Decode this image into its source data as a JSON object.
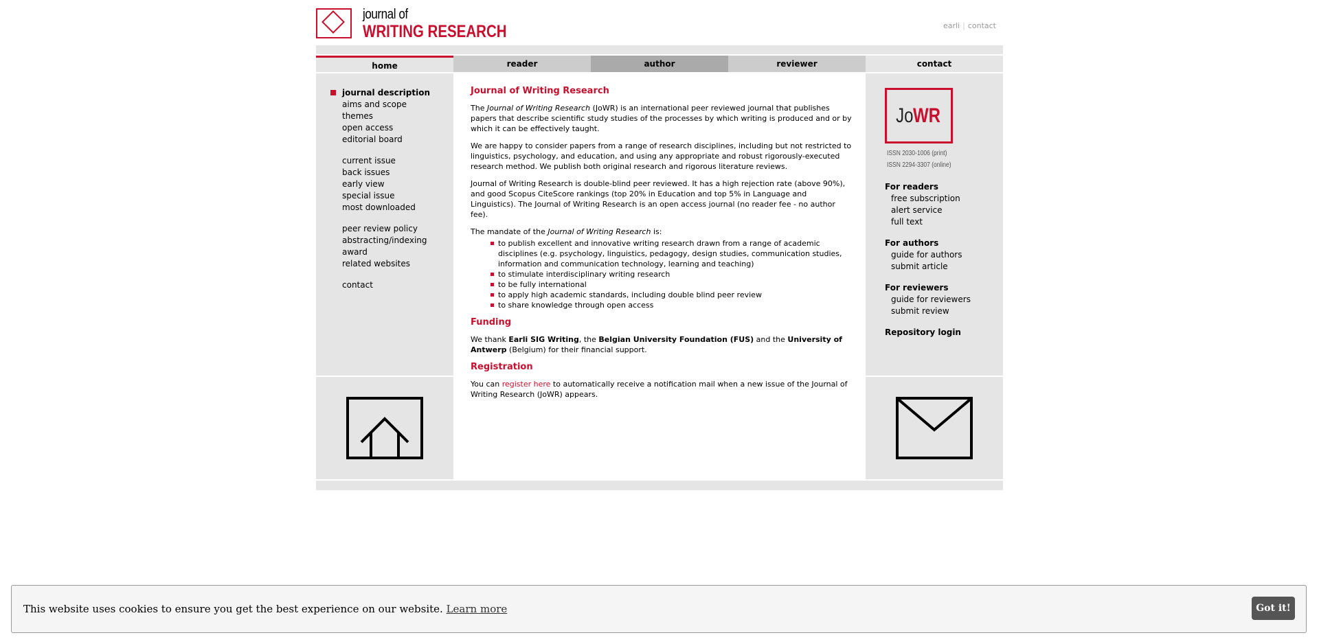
{
  "header": {
    "logo_line1": "journal of",
    "logo_line2": "WRITING RESEARCH",
    "toplinks": [
      "earli",
      "contact"
    ]
  },
  "nav": {
    "tabs": [
      {
        "label": "home"
      },
      {
        "label": "reader"
      },
      {
        "label": "author"
      },
      {
        "label": "reviewer"
      },
      {
        "label": "contact"
      }
    ]
  },
  "left_nav": {
    "group1": [
      "journal description",
      "aims and scope",
      "themes",
      "open access",
      "editorial board"
    ],
    "group2": [
      "current issue",
      "back issues",
      "early view",
      "special issue",
      "most downloaded"
    ],
    "group3": [
      "peer review policy",
      "abstracting/indexing",
      "award",
      "related websites"
    ],
    "group4": [
      "contact"
    ]
  },
  "main": {
    "title": "Journal of Writing Research",
    "p1_a": "The ",
    "p1_b": "Journal of Writing Research",
    "p1_c": " (JoWR) is an international peer reviewed journal that publishes papers that describe scientific study studies of the processes by which writing is produced and or by which it can be effectively taught.",
    "p2": "We are happy to consider papers from a range of research disciplines, including but not restricted to linguistics, psychology, and education, and using any appropriate and robust rigorously-executed research method. We publish both original research and rigorous literature reviews.",
    "p3": "Journal of Writing Research is double-blind peer reviewed. It has a high rejection rate (above 90%), and good Scopus CiteScore rankings (top 20% in Education and top 5% in Language and Linguistics). The Journal of Writing Research is an open access journal (no reader fee - no author fee).",
    "p4_a": "The mandate of the ",
    "p4_b": "Journal of Writing Research",
    "p4_c": " is:",
    "mandate": [
      "to publish excellent and innovative writing research drawn from a range of academic disciplines (e.g. psychology, linguistics, pedagogy, design studies, communication studies, information and communication technology, learning and teaching)",
      "to stimulate interdisciplinary writing research",
      "to be fully international",
      "to apply high academic standards, including double blind peer review",
      "to share knowledge through open access"
    ],
    "funding_title": "Funding",
    "funding_a": "We thank ",
    "funding_b": "Earli SIG Writing",
    "funding_c": ", the ",
    "funding_d": "Belgian University Foundation (FUS)",
    "funding_e": " and the ",
    "funding_f": "University of Antwerp",
    "funding_g": " (Belgium) for their financial support.",
    "registration_title": "Registration",
    "reg_a": "You can ",
    "reg_link": "register here",
    "reg_b": " to automatically receive a notification mail when a new issue of the Journal of Writing Research (JoWR) appears."
  },
  "right": {
    "logo_jo": "Jo",
    "logo_wr": "WR",
    "issn_print": "ISSN 2030-1006 (print)",
    "issn_online": "ISSN 2294-3307 (online)",
    "readers_head": "For readers",
    "readers": [
      "free subscription",
      "alert service",
      "full text"
    ],
    "authors_head": "For authors",
    "authors": [
      "guide for authors",
      "submit article"
    ],
    "reviewers_head": "For reviewers",
    "reviewers": [
      "guide for reviewers",
      "submit review"
    ],
    "repository": "Repository login"
  },
  "cookie": {
    "message": "This website uses cookies to ensure you get the best experience on our website.",
    "learn_more": "Learn more",
    "button": "Got it!"
  },
  "colors": {
    "accent": "#c8102e",
    "panel": "#e5e5e5"
  }
}
